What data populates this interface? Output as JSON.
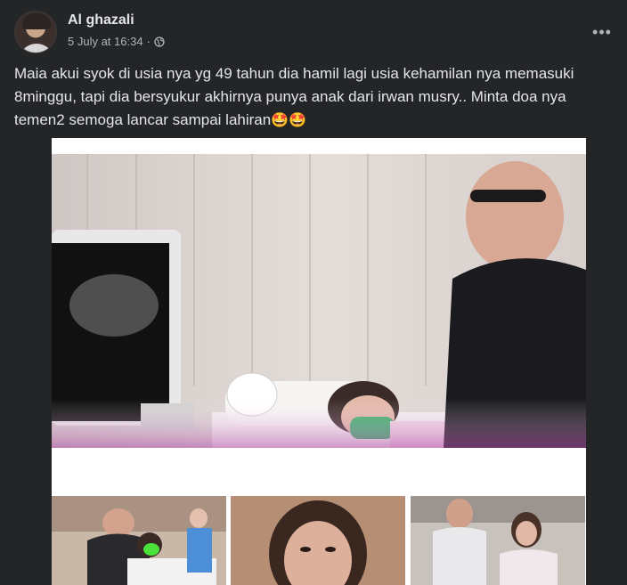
{
  "post": {
    "author": "Al ghazali",
    "timestamp": "5 July at 16:34",
    "separator": "·",
    "privacy_icon": "globe-icon",
    "more_label": "•••",
    "caption_text": "Maia akui syok di usia nya yg 49 tahun dia hamil lagi usia kehamilan nya memasuki 8minggu, tapi dia bersyukur akhirnya punya anak dari irwan musry.. Minta doa nya temen2 semoga lancar sampai lahiran",
    "caption_emoji": "🤩🤩"
  },
  "colors": {
    "background": "#242526",
    "text_primary": "#e4e6eb",
    "text_secondary": "#b0b3b8",
    "media_frame": "#ffffff"
  }
}
